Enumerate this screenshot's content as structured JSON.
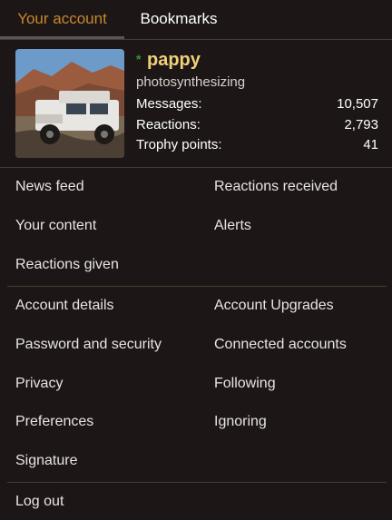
{
  "tabs": {
    "account": "Your account",
    "bookmarks": "Bookmarks"
  },
  "profile": {
    "username": "pappy",
    "online_marker": "*",
    "user_title": "photosynthesizing",
    "stats": [
      {
        "label": "Messages:",
        "value": "10,507"
      },
      {
        "label": "Reactions:",
        "value": "2,793"
      },
      {
        "label": "Trophy points:",
        "value": "41"
      }
    ]
  },
  "menu": {
    "group1": {
      "left": [
        "News feed",
        "Your content",
        "Reactions given"
      ],
      "right": [
        "Reactions received",
        "Alerts"
      ]
    },
    "group2": {
      "left": [
        "Account details",
        "Password and security",
        "Privacy",
        "Preferences",
        "Signature"
      ],
      "right": [
        "Account Upgrades",
        "Connected accounts",
        "Following",
        "Ignoring"
      ]
    },
    "logout": "Log out"
  },
  "colors": {
    "background": "#1c1716",
    "accent": "#c8862e",
    "username": "#f2d079",
    "online": "#2e9b2e"
  }
}
